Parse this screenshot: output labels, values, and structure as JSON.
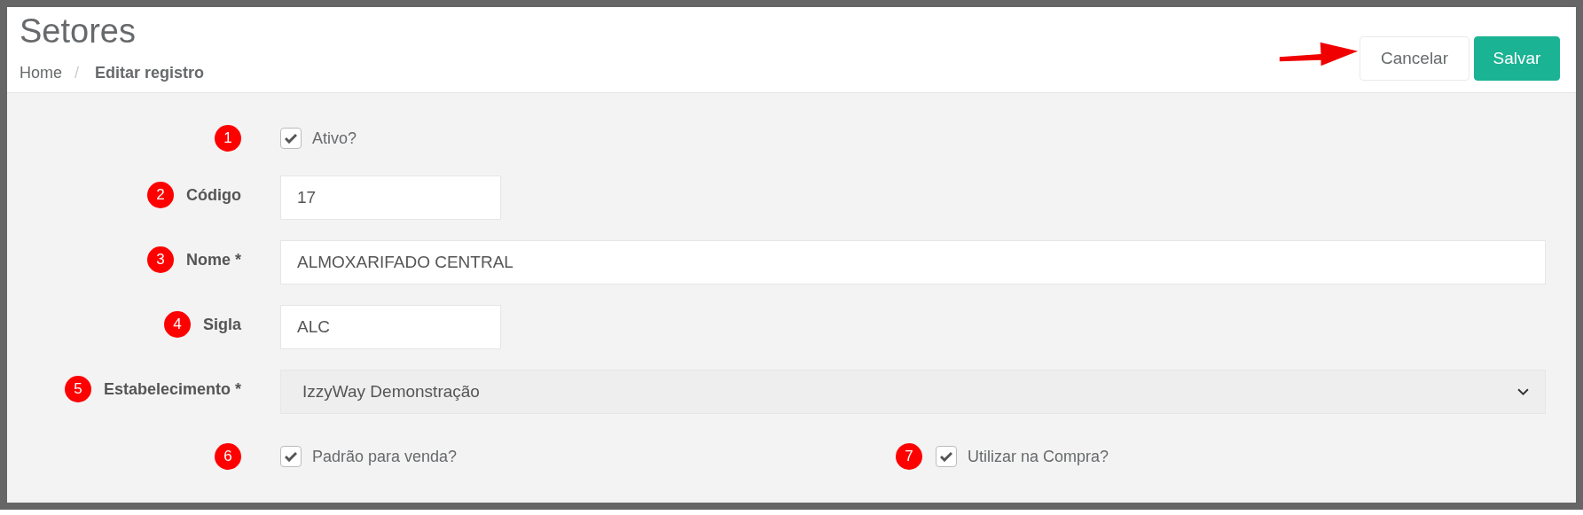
{
  "header": {
    "title": "Setores",
    "separator": "/",
    "breadcrumb": [
      {
        "label": "Home",
        "current": false
      },
      {
        "label": "Editar registro",
        "current": true
      }
    ]
  },
  "actions": [
    {
      "label": "Cancelar",
      "kind": "secondary"
    },
    {
      "label": "Salvar",
      "kind": "primary"
    }
  ],
  "fields": [
    {
      "kind": "checkbox",
      "marker": "1",
      "label": "Ativo?",
      "checked": true
    },
    {
      "kind": "text",
      "marker": "2",
      "label": "Código",
      "value": "17"
    },
    {
      "kind": "wide-text",
      "marker": "3",
      "label": "Nome *",
      "value": "ALMOXARIFADO CENTRAL"
    },
    {
      "kind": "text",
      "marker": "4",
      "label": "Sigla",
      "value": "ALC"
    },
    {
      "kind": "select",
      "marker": "5",
      "label": "Estabelecimento *",
      "value": "IzzyWay Demonstração"
    },
    {
      "kind": "checkbox-pair",
      "items": [
        {
          "marker": "6",
          "label": "Padrão para venda?",
          "checked": true
        },
        {
          "marker": "7",
          "label": "Utilizar na Compra?",
          "checked": true
        }
      ]
    }
  ]
}
